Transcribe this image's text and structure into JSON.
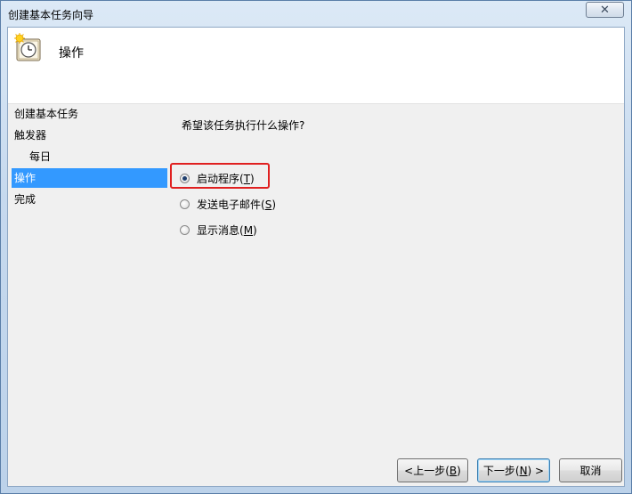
{
  "window": {
    "title": "创建基本任务向导",
    "close_glyph": "✕"
  },
  "header": {
    "title": "操作",
    "icon": "task-clock-icon"
  },
  "nav": {
    "items": [
      {
        "label": "创建基本任务",
        "level": 0,
        "active": false
      },
      {
        "label": "触发器",
        "level": 0,
        "active": false
      },
      {
        "label": "每日",
        "level": 1,
        "active": false
      },
      {
        "label": "操作",
        "level": 0,
        "active": true
      },
      {
        "label": "完成",
        "level": 0,
        "active": false
      }
    ]
  },
  "main": {
    "question": "希望该任务执行什么操作?",
    "options": [
      {
        "label_pre": "启动程序(",
        "key": "T",
        "label_post": ")",
        "checked": true
      },
      {
        "label_pre": "发送电子邮件(",
        "key": "S",
        "label_post": ")",
        "checked": false
      },
      {
        "label_pre": "显示消息(",
        "key": "M",
        "label_post": ")",
        "checked": false
      }
    ]
  },
  "footer": {
    "back": {
      "pre": "<上一步(",
      "key": "B",
      "post": ")"
    },
    "next": {
      "pre": "下一步(",
      "key": "N",
      "post": ") >"
    },
    "cancel": "取消"
  },
  "colors": {
    "selection": "#3399ff",
    "highlight_box": "#e02020"
  }
}
